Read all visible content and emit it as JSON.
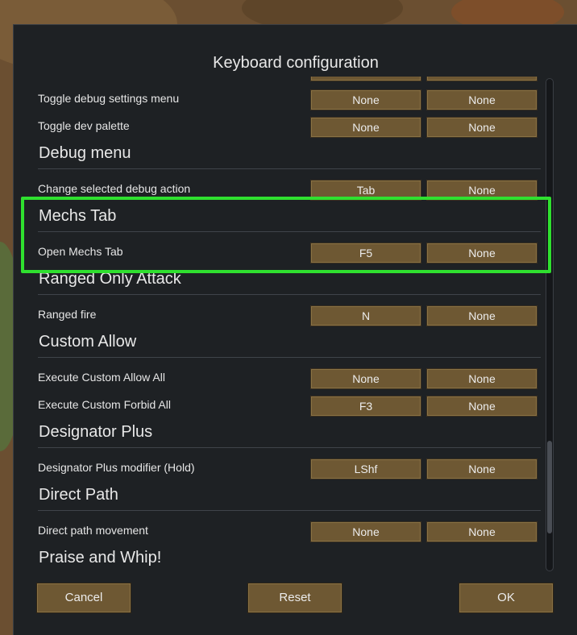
{
  "dialog": {
    "title": "Keyboard configuration",
    "bottom_buttons": {
      "cancel": "Cancel",
      "reset": "Reset",
      "ok": "OK"
    }
  },
  "rows": [
    {
      "kind": "binding",
      "label": "Toggle debug settings menu",
      "key1": "None",
      "key2": "None"
    },
    {
      "kind": "binding",
      "label": "Toggle dev palette",
      "key1": "None",
      "key2": "None"
    },
    {
      "kind": "category",
      "label": "Debug menu"
    },
    {
      "kind": "binding",
      "label": "Change selected debug action",
      "key1": "Tab",
      "key2": "None"
    },
    {
      "kind": "category",
      "label": "Mechs Tab"
    },
    {
      "kind": "binding",
      "label": "Open Mechs Tab",
      "key1": "F5",
      "key2": "None"
    },
    {
      "kind": "category",
      "label": "Ranged Only Attack"
    },
    {
      "kind": "binding",
      "label": "Ranged fire",
      "key1": "N",
      "key2": "None"
    },
    {
      "kind": "category",
      "label": "Custom Allow"
    },
    {
      "kind": "binding",
      "label": "Execute Custom Allow All",
      "key1": "None",
      "key2": "None"
    },
    {
      "kind": "binding",
      "label": "Execute Custom Forbid All",
      "key1": "F3",
      "key2": "None"
    },
    {
      "kind": "category",
      "label": "Designator Plus"
    },
    {
      "kind": "binding",
      "label": "Designator Plus modifier (Hold)",
      "key1": "LShf",
      "key2": "None"
    },
    {
      "kind": "category",
      "label": "Direct Path"
    },
    {
      "kind": "binding",
      "label": "Direct path movement",
      "key1": "None",
      "key2": "None"
    },
    {
      "kind": "category",
      "label": "Praise and Whip!"
    }
  ],
  "highlighted_section": "Mechs Tab",
  "colors": {
    "dialog_bg": "#1e2124",
    "button_bg": "#6e5833",
    "highlight": "#2fe02f"
  }
}
